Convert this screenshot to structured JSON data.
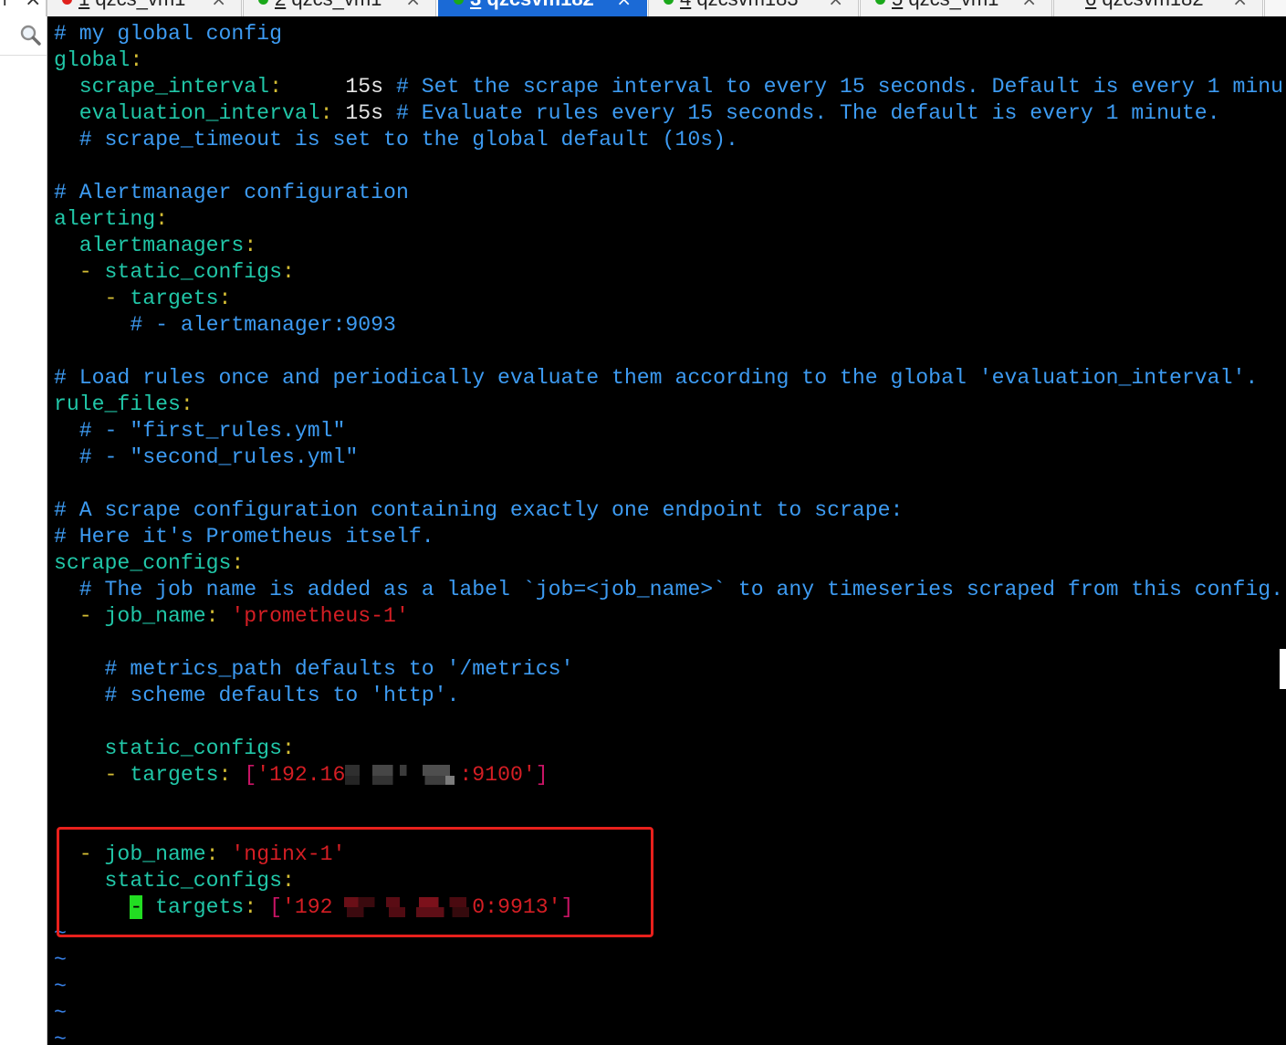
{
  "window": {
    "controls": {
      "add": "+",
      "close": "×"
    },
    "tab_close": "×",
    "tabs": [
      {
        "number": "1",
        "name": "qzcs_vm1",
        "dot_color": "#e0201c",
        "active": false
      },
      {
        "number": "2",
        "name": "qzcs_vm1",
        "dot_color": "#1aa81a",
        "active": false
      },
      {
        "number": "3",
        "name": "qzcsvm182",
        "dot_color": "#1aa81a",
        "active": true
      },
      {
        "number": "4",
        "name": "qzcsvm183",
        "dot_color": "#1aa81a",
        "active": false
      },
      {
        "number": "5",
        "name": "qzcs_vm1",
        "dot_color": "#1aa81a",
        "active": false
      },
      {
        "number": "6",
        "name": "qzcsvm182",
        "dot_color": null,
        "active": false
      }
    ]
  },
  "sidebar": {
    "icon": "search-icon"
  },
  "editor": {
    "syntax_colors": {
      "background": "#000000",
      "comment": "#3d9bf2",
      "key": "#21c7a8",
      "punct": "#d4bd34",
      "value": "#e6e6e6",
      "string": "#d41e24",
      "bracket": "#c81465",
      "tilde": "#3a86f0",
      "cursor": "#22dd22"
    },
    "lines": [
      [
        {
          "comment": "# my global config"
        }
      ],
      [
        {
          "key": "global"
        },
        {
          "punct": ":"
        }
      ],
      [
        {
          "key": "  scrape_interval"
        },
        {
          "punct": ":"
        },
        {
          "value": "     15s "
        },
        {
          "comment": "# Set the scrape interval to every 15 seconds. Default is every 1 minu"
        }
      ],
      [
        {
          "key": "  evaluation_interval"
        },
        {
          "punct": ":"
        },
        {
          "value": " 15s "
        },
        {
          "comment": "# Evaluate rules every 15 seconds. The default is every 1 minute."
        }
      ],
      [
        {
          "comment": "  # scrape_timeout is set to the global default (10s)."
        }
      ],
      [],
      [
        {
          "comment": "# Alertmanager configuration"
        }
      ],
      [
        {
          "key": "alerting"
        },
        {
          "punct": ":"
        }
      ],
      [
        {
          "key": "  alertmanagers"
        },
        {
          "punct": ":"
        }
      ],
      [
        {
          "punct": "  - "
        },
        {
          "key": "static_configs"
        },
        {
          "punct": ":"
        }
      ],
      [
        {
          "punct": "    - "
        },
        {
          "key": "targets"
        },
        {
          "punct": ":"
        }
      ],
      [
        {
          "comment": "      # - alertmanager:9093"
        }
      ],
      [],
      [
        {
          "comment": "# Load rules once and periodically evaluate them according to the global 'evaluation_interval'."
        }
      ],
      [
        {
          "key": "rule_files"
        },
        {
          "punct": ":"
        }
      ],
      [
        {
          "comment": "  # - \"first_rules.yml\""
        }
      ],
      [
        {
          "comment": "  # - \"second_rules.yml\""
        }
      ],
      [],
      [
        {
          "comment": "# A scrape configuration containing exactly one endpoint to scrape:"
        }
      ],
      [
        {
          "comment": "# Here it's Prometheus itself."
        }
      ],
      [
        {
          "key": "scrape_configs"
        },
        {
          "punct": ":"
        }
      ],
      [
        {
          "comment": "  # The job name is added as a label `job=<job_name>` to any timeseries scraped from this config."
        }
      ],
      [
        {
          "punct": "  - "
        },
        {
          "key": "job_name"
        },
        {
          "punct": ": "
        },
        {
          "string": "'prometheus-1'"
        }
      ],
      [],
      [
        {
          "comment": "    # metrics_path defaults to '/metrics'"
        }
      ],
      [
        {
          "comment": "    # scheme defaults to 'http'."
        }
      ],
      [],
      [
        {
          "key": "    static_configs"
        },
        {
          "punct": ":"
        }
      ],
      [
        {
          "punct": "    - "
        },
        {
          "key": "targets"
        },
        {
          "punct": ": "
        },
        {
          "bracket": "["
        },
        {
          "string": "'192.16"
        },
        {
          "redacted": true
        },
        {
          "string": ":9100'"
        },
        {
          "bracket": "]"
        }
      ],
      [],
      [],
      [
        {
          "punct": "  - "
        },
        {
          "key": "job_name"
        },
        {
          "punct": ": "
        },
        {
          "string": "'nginx-1'"
        }
      ],
      [
        {
          "key": "    static_configs"
        },
        {
          "punct": ":"
        }
      ],
      [
        {
          "punct": "      "
        },
        {
          "cursor": "-"
        },
        {
          "punct": " "
        },
        {
          "key": "targets"
        },
        {
          "punct": ": "
        },
        {
          "bracket": "["
        },
        {
          "string": "'192"
        },
        {
          "redacted": true
        },
        {
          "string": "0:9913'"
        },
        {
          "bracket": "]"
        }
      ],
      [
        {
          "tilde": "~"
        }
      ],
      [
        {
          "tilde": "~"
        }
      ],
      [
        {
          "tilde": "~"
        }
      ],
      [
        {
          "tilde": "~"
        }
      ],
      [
        {
          "tilde": "~"
        }
      ]
    ]
  },
  "annotation": {
    "color": "#e8201c"
  }
}
